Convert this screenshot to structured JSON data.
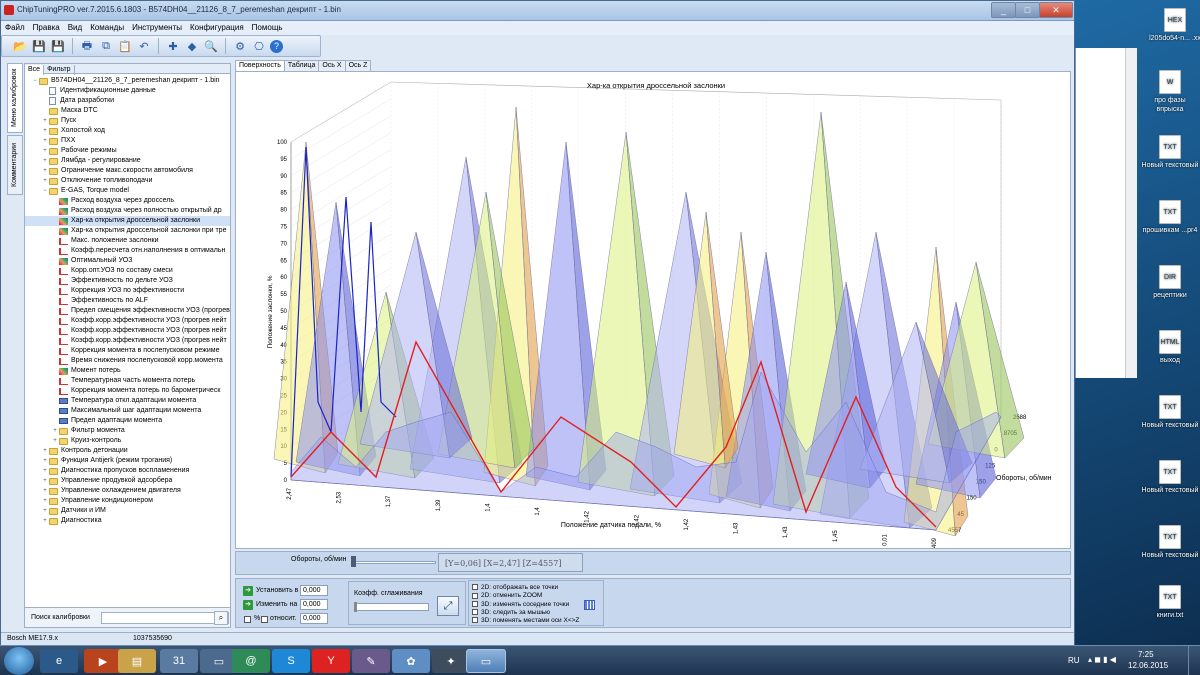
{
  "window": {
    "title": "ChipTuningPRO ver.7.2015.6.1803 - B574DH04__21126_8_7_peremeshan декрипт - 1.bin"
  },
  "menu": [
    "Файл",
    "Правка",
    "Вид",
    "Команды",
    "Инструменты",
    "Конфигурация",
    "Помощь"
  ],
  "toolbar_icons": [
    "open-icon",
    "save-icon",
    "save-as-icon",
    "print-icon",
    "copy-icon",
    "paste-icon",
    "undo-icon",
    "checksum-icon",
    "diamond-icon",
    "zoom-icon",
    "settings-icon",
    "network-icon",
    "help-icon"
  ],
  "vertical_tabs": [
    "Меню калибровок",
    "Комментарии"
  ],
  "left_tabs": [
    "Все",
    "Фильтр"
  ],
  "tree": [
    {
      "level": 0,
      "expander": "−",
      "icon": "folder",
      "label": "B574DH04__21126_8_7_peremeshan декрипт - 1.bin"
    },
    {
      "level": 1,
      "expander": "",
      "icon": "doc",
      "label": "Идентификационные данные"
    },
    {
      "level": 1,
      "expander": "",
      "icon": "doc",
      "label": "Дата разработки"
    },
    {
      "level": 1,
      "expander": "",
      "icon": "folder",
      "label": "Маска DTC"
    },
    {
      "level": 1,
      "expander": "+",
      "icon": "folder",
      "label": "Пуск"
    },
    {
      "level": 1,
      "expander": "+",
      "icon": "folder",
      "label": "Холостой ход"
    },
    {
      "level": 1,
      "expander": "+",
      "icon": "folder",
      "label": "ПХХ"
    },
    {
      "level": 1,
      "expander": "+",
      "icon": "folder",
      "label": "Рабочие режимы"
    },
    {
      "level": 1,
      "expander": "+",
      "icon": "folder",
      "label": "Лямбда - регулирование"
    },
    {
      "level": 1,
      "expander": "+",
      "icon": "folder",
      "label": "Ограничение макс.скорости автомобиля"
    },
    {
      "level": 1,
      "expander": "+",
      "icon": "folder",
      "label": "Отключение топливоподачи"
    },
    {
      "level": 1,
      "expander": "−",
      "icon": "folder",
      "label": "E-GAS, Torque model"
    },
    {
      "level": 2,
      "expander": "",
      "icon": "chart3d",
      "label": "Расход воздуха через дроссель"
    },
    {
      "level": 2,
      "expander": "",
      "icon": "chart3d",
      "label": "Расход воздуха через полностью открытый др"
    },
    {
      "level": 2,
      "expander": "",
      "icon": "chart3d",
      "label": "Хар-ка открытия дроссельной заслонки"
    },
    {
      "level": 2,
      "expander": "",
      "icon": "chart3d",
      "label": "Хар-ка открытия дроссельной заслонки при тре"
    },
    {
      "level": 2,
      "expander": "",
      "icon": "chart2d",
      "label": "Макс. положение заслонки"
    },
    {
      "level": 2,
      "expander": "",
      "icon": "chart2d",
      "label": "Коэфф.пересчета отн.наполнения в оптимальн"
    },
    {
      "level": 2,
      "expander": "",
      "icon": "chart3d",
      "label": "Оптимальный УОЗ"
    },
    {
      "level": 2,
      "expander": "",
      "icon": "chart2d",
      "label": "Корр.опт.УОЗ по составу смеси"
    },
    {
      "level": 2,
      "expander": "",
      "icon": "chart2d",
      "label": "Эффективность по дельте УОЗ"
    },
    {
      "level": 2,
      "expander": "",
      "icon": "chart2d",
      "label": "Коррекция УОЗ по эффективности"
    },
    {
      "level": 2,
      "expander": "",
      "icon": "chart2d",
      "label": "Эффективность по ALF"
    },
    {
      "level": 2,
      "expander": "",
      "icon": "chart2d",
      "label": "Предел смещения эффективности УОЗ (прогрев"
    },
    {
      "level": 2,
      "expander": "",
      "icon": "chart2d",
      "label": "Коэфф.корр.эффективности УОЗ (прогрев нейт"
    },
    {
      "level": 2,
      "expander": "",
      "icon": "chart2d",
      "label": "Коэфф.корр.эффективности УОЗ (прогрев нейт"
    },
    {
      "level": 2,
      "expander": "",
      "icon": "chart2d",
      "label": "Коэфф.корр.эффективности УОЗ (прогрев нейт"
    },
    {
      "level": 2,
      "expander": "",
      "icon": "chart2d",
      "label": "Коррекция момента в послепусковом режиме"
    },
    {
      "level": 2,
      "expander": "",
      "icon": "chart2d",
      "label": "Время снижения послепусковой корр.момента"
    },
    {
      "level": 2,
      "expander": "",
      "icon": "chart3d",
      "label": "Момент потерь"
    },
    {
      "level": 2,
      "expander": "",
      "icon": "chart2d",
      "label": "Температурная часть момента потерь"
    },
    {
      "level": 2,
      "expander": "",
      "icon": "chart2d",
      "label": "Коррекция момента потерь по барометрическ"
    },
    {
      "level": 2,
      "expander": "",
      "icon": "scalar",
      "label": "Температура откл.адаптации момента"
    },
    {
      "level": 2,
      "expander": "",
      "icon": "scalar",
      "label": "Максимальный шаг адаптации момента"
    },
    {
      "level": 2,
      "expander": "",
      "icon": "scalar",
      "label": "Предел адаптации момента"
    },
    {
      "level": 2,
      "expander": "+",
      "icon": "folder",
      "label": "Фильтр момента"
    },
    {
      "level": 2,
      "expander": "+",
      "icon": "folder",
      "label": "Круиз-контроль"
    },
    {
      "level": 1,
      "expander": "+",
      "icon": "folder",
      "label": "Контроль детонации"
    },
    {
      "level": 1,
      "expander": "+",
      "icon": "folder",
      "label": "Функция Antijerk (режим трогания)"
    },
    {
      "level": 1,
      "expander": "+",
      "icon": "folder",
      "label": "Диагностика пропусков воспламенения"
    },
    {
      "level": 1,
      "expander": "+",
      "icon": "folder",
      "label": "Управление продувкой адсорбера"
    },
    {
      "level": 1,
      "expander": "+",
      "icon": "folder",
      "label": "Управление охлаждением двигателя"
    },
    {
      "level": 1,
      "expander": "+",
      "icon": "folder",
      "label": "Управление кондиционером"
    },
    {
      "level": 1,
      "expander": "+",
      "icon": "folder",
      "label": "Датчики и ИМ"
    },
    {
      "level": 1,
      "expander": "+",
      "icon": "folder",
      "label": "Диагностика"
    }
  ],
  "search": {
    "label": "Поиск калибровки"
  },
  "right_tabs": [
    "Поверхность",
    "Таблица",
    "Ось X",
    "Ось Z"
  ],
  "chart_data": {
    "type": "surface3d",
    "title": "Хар-ка открытия дроссельной заслонки",
    "xlabel": "Положение датчика педали, %",
    "ylabel": "Положение заслонки, %",
    "zlabel": "Обороты, об/мин",
    "y_ticks": [
      "0",
      "5",
      "10",
      "15",
      "20",
      "25",
      "30",
      "35",
      "40",
      "45",
      "50",
      "55",
      "60",
      "65",
      "70",
      "75",
      "80",
      "85",
      "90",
      "95",
      "100"
    ],
    "x_ticks": [
      "2,47",
      "2,53",
      "1,37",
      "1,39",
      "1,4",
      "1,4",
      "1,42",
      "1,42",
      "1,42",
      "1,43",
      "1,43",
      "1,45",
      "0,01",
      "1,409"
    ],
    "z_ticks": [
      "2688",
      "8705",
      "0",
      "125",
      "150",
      "150",
      "45",
      "4557"
    ],
    "ylim": [
      0,
      100
    ]
  },
  "controls": {
    "rpm_label": "Обороты, об/мин",
    "checkbox_3d": "3D",
    "readout": "[Y=0,06] [X=2,47] [Z=4557]",
    "set_label": "Установить в",
    "change_label": "Изменить на",
    "percent_label": "%",
    "relative_label": "относит.",
    "set_value": "0,000",
    "change_value": "0,000",
    "rel_value": "0,000",
    "smooth_label": "Коэфф. сглаживания",
    "options": [
      "2D: отображать все точки",
      "2D: отменить ZOOM",
      "3D: изменять соседние точки",
      "3D: следить за мышью",
      "3D: поменять местами оси X<>Z"
    ]
  },
  "status": {
    "ecu": "Bosch ME17.9.x",
    "id": "1037535690"
  },
  "desktop_icons": [
    {
      "label": "l205do54-n... .xx",
      "glyph": "HEX"
    },
    {
      "label": "про фазы впрыска",
      "glyph": "W"
    },
    {
      "label": "Новый текстовый",
      "glyph": "TXT"
    },
    {
      "label": "прошивкам ...рг4",
      "glyph": "TXT"
    },
    {
      "label": "рецептики",
      "glyph": "DIR"
    },
    {
      "label": "выход",
      "glyph": "HTML"
    },
    {
      "label": "Новый текстовый",
      "glyph": "TXT"
    },
    {
      "label": "Новый текстовый",
      "glyph": "TXT"
    },
    {
      "label": "Новый текстовый",
      "glyph": "TXT"
    },
    {
      "label": "книги.txt",
      "glyph": "TXT"
    }
  ],
  "tray": {
    "lang": "RU",
    "time": "7:25",
    "date": "12.06.2015"
  }
}
